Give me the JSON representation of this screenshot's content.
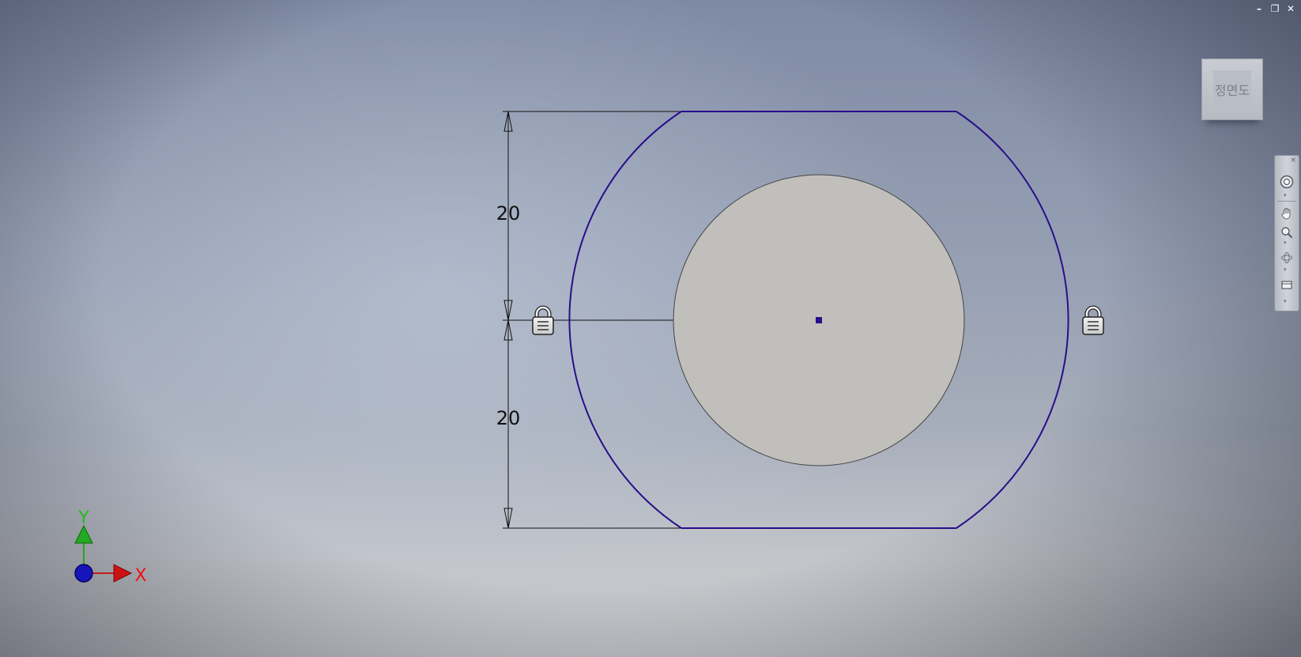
{
  "window_controls": {
    "minimize": "–",
    "restore": "❐",
    "close": "✕"
  },
  "sketch": {
    "dimensions": {
      "upper": "20",
      "lower": "20"
    },
    "colors": {
      "profile": "#2a0d8a",
      "dimension": "#111111",
      "fill": "#c0bfbb"
    }
  },
  "axes": {
    "x_label": "X",
    "y_label": "Y"
  },
  "viewcube": {
    "label": "정면도"
  },
  "navigation_bar": {
    "tools": [
      "steering-wheel-icon",
      "pan-icon",
      "zoom-icon",
      "orbit-icon",
      "view-face-icon"
    ],
    "close": "×"
  },
  "icons": {
    "lock": "lock-icon"
  }
}
